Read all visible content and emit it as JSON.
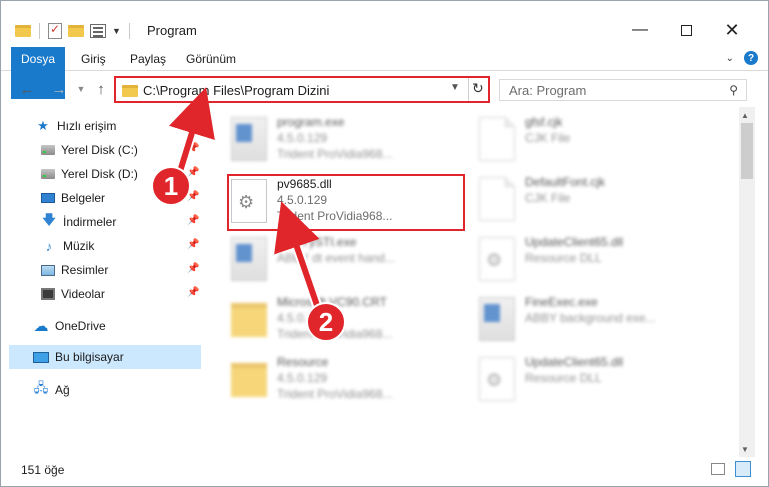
{
  "window": {
    "title": "Program"
  },
  "ribbon": {
    "tabs": [
      "Dosya",
      "Giriş",
      "Paylaş",
      "Görünüm"
    ]
  },
  "address": {
    "path": "C:\\Program Files\\Program Dizini"
  },
  "search": {
    "placeholder": "Ara: Program"
  },
  "sidebar": {
    "items": [
      {
        "label": "Hızlı erişim"
      },
      {
        "label": "Yerel Disk (C:)"
      },
      {
        "label": "Yerel Disk (D:)"
      },
      {
        "label": "Belgeler"
      },
      {
        "label": "İndirmeler"
      },
      {
        "label": "Müzik"
      },
      {
        "label": "Resimler"
      },
      {
        "label": "Videolar"
      },
      {
        "label": "OneDrive"
      },
      {
        "label": "Bu bilgisayar"
      },
      {
        "label": "Ağ"
      }
    ]
  },
  "files": [
    {
      "name": "program.exe",
      "version": "4.5.0.129",
      "description": "Trident ProVidia968..."
    },
    {
      "name": "pv9685.dll",
      "version": "4.5.0.129",
      "description": "Trident ProVidia968..."
    },
    {
      "name": "ABBYySTI.exe",
      "version": "ABBY dt event hand..."
    },
    {
      "name": "Microsoft.VC90.CRT",
      "version": "4.5.0.129",
      "description": "Trident ProVidia968..."
    },
    {
      "name": "Resource",
      "version": "4.5.0.129",
      "description": "Trident ProVidia968..."
    },
    {
      "name": "gfsf.cjk",
      "version": "CJK File"
    },
    {
      "name": "DefaultFont.cjk",
      "version": "CJK File"
    },
    {
      "name": "UpdateClient65.dll",
      "version": "Resource DLL"
    },
    {
      "name": "FineExec.exe",
      "version": "ABBY background exe..."
    },
    {
      "name": "UpdateClient65.dll",
      "version": "Resource DLL"
    }
  ],
  "status": {
    "item_count": "151 öğe"
  },
  "callouts": [
    "1",
    "2"
  ],
  "colors": {
    "accent": "#1979ca",
    "highlight": "#e0262b",
    "selected": "#cce8ff"
  }
}
